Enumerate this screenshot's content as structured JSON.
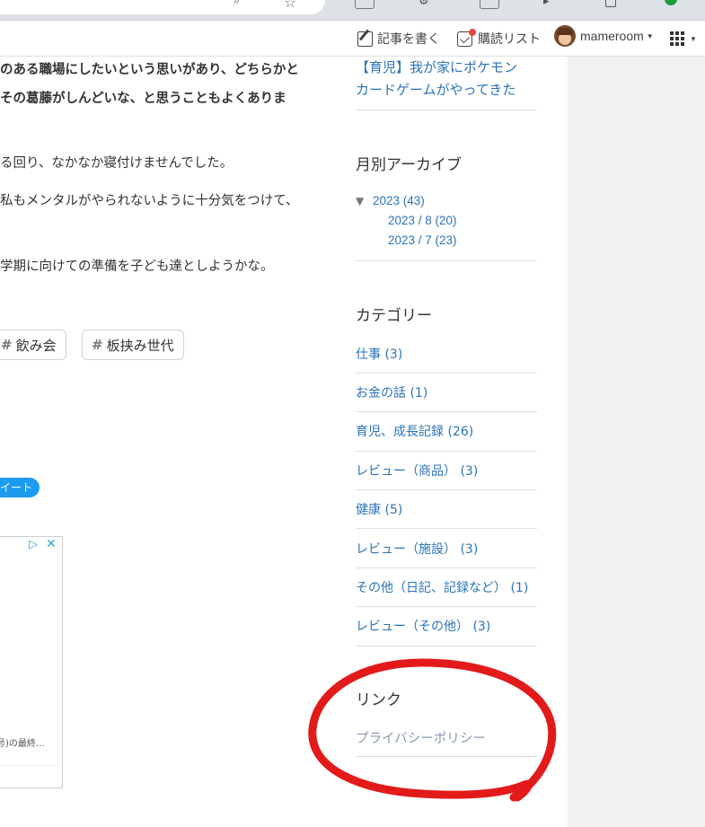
{
  "toolbar": {
    "write_label": "記事を書く",
    "reading_list_label": "購読リスト",
    "username": "mameroom"
  },
  "article": {
    "line1": "のある職場にしたいという思いがあり、どちらかと",
    "line2": "その葛藤がしんどいな、と思うこともよくありま",
    "line3": "る回り、なかなか寝付けませんでした。",
    "line4": "私もメンタルがやられないように十分気をつけて、",
    "line5": "学期に向けての準備を子ども達としようかな。",
    "tags": [
      "飲み会",
      "板挟み世代"
    ],
    "tag_hash": "#",
    "tweet_label": "イート",
    "ad_text": "号)の最終…"
  },
  "sidebar": {
    "recent_entry": {
      "line1": "【育児】我が家にポケモン",
      "line2": "カードゲームがやってきた"
    },
    "archive": {
      "title": "月別アーカイブ",
      "toggle": "▼",
      "year": "2023 (43)",
      "months": [
        "2023 / 8 (20)",
        "2023 / 7 (23)"
      ]
    },
    "categories": {
      "title": "カテゴリー",
      "items": [
        "仕事 (3)",
        "お金の話 (1)",
        "育児、成長記録 (26)",
        "レビュー（商品） (3)",
        "健康 (5)",
        "レビュー（施設） (3)",
        "その他（日記、記録など） (1)",
        "レビュー（その他） (3)"
      ]
    },
    "links": {
      "title": "リンク",
      "privacy": "プライバシーポリシー"
    }
  },
  "colors": {
    "link": "#2b73b6",
    "annotation": "#e21a1a",
    "tweet": "#1d9bf0"
  }
}
